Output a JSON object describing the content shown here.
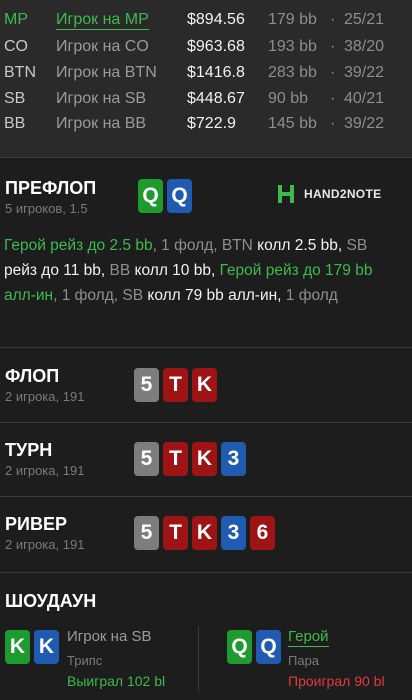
{
  "players": [
    {
      "pos": "MP",
      "name": "Игрок на MP",
      "stack": "$894.56",
      "bb": "179 bb",
      "sep": "·",
      "record": "25/21",
      "hero": true
    },
    {
      "pos": "CO",
      "name": "Игрок на CO",
      "stack": "$963.68",
      "bb": "193 bb",
      "sep": "·",
      "record": "38/20",
      "hero": false
    },
    {
      "pos": "BTN",
      "name": "Игрок на BTN",
      "stack": "$1416.8",
      "bb": "283 bb",
      "sep": "·",
      "record": "39/22",
      "hero": false
    },
    {
      "pos": "SB",
      "name": "Игрок на SB",
      "stack": "$448.67",
      "bb": "90 bb",
      "sep": "·",
      "record": "40/21",
      "hero": false
    },
    {
      "pos": "BB",
      "name": "Игрок на BB",
      "stack": "$722.9",
      "bb": "145 bb",
      "sep": "·",
      "record": "39/22",
      "hero": false
    }
  ],
  "preflop": {
    "title": "ПРЕФЛОП",
    "subtitle": "5 игроков, 1.5",
    "hero_cards": [
      {
        "rank": "Q",
        "color": "green"
      },
      {
        "rank": "Q",
        "color": "blue"
      }
    ],
    "logo_text": "HAND2NOTE",
    "actions": [
      {
        "text": "Герой рейз до 2.5 bb",
        "style": "hero"
      },
      {
        "text": ", 1 фолд, ",
        "style": "gray"
      },
      {
        "text": "BTN",
        "style": "gray"
      },
      {
        "text": " колл 2.5 bb,",
        "style": "white"
      },
      {
        "text": " SB",
        "style": "gray"
      },
      {
        "text": " рейз до 11 bb, ",
        "style": "white"
      },
      {
        "text": "BB",
        "style": "gray"
      },
      {
        "text": " колл 10 bb, ",
        "style": "white"
      },
      {
        "text": "Герой рейз до 179 bb алл-ин",
        "style": "hero"
      },
      {
        "text": ", 1 фолд, ",
        "style": "gray"
      },
      {
        "text": "SB",
        "style": "gray"
      },
      {
        "text": " колл 79 bb алл-ин, ",
        "style": "white"
      },
      {
        "text": "1 фолд",
        "style": "gray"
      }
    ]
  },
  "flop": {
    "title": "ФЛОП",
    "subtitle": "2 игрока, 191",
    "cards": [
      {
        "rank": "5",
        "color": "gray"
      },
      {
        "rank": "T",
        "color": "red"
      },
      {
        "rank": "K",
        "color": "red"
      }
    ]
  },
  "turn": {
    "title": "ТУРН",
    "subtitle": "2 игрока, 191",
    "cards": [
      {
        "rank": "5",
        "color": "gray"
      },
      {
        "rank": "T",
        "color": "red"
      },
      {
        "rank": "K",
        "color": "red"
      },
      {
        "rank": "3",
        "color": "blue"
      }
    ]
  },
  "river": {
    "title": "РИВЕР",
    "subtitle": "2 игрока, 191",
    "cards": [
      {
        "rank": "5",
        "color": "gray"
      },
      {
        "rank": "T",
        "color": "red"
      },
      {
        "rank": "K",
        "color": "red"
      },
      {
        "rank": "3",
        "color": "blue"
      },
      {
        "rank": "6",
        "color": "red"
      }
    ]
  },
  "showdown": {
    "title": "ШОУДАУН",
    "left": {
      "cards": [
        {
          "rank": "K",
          "color": "green"
        },
        {
          "rank": "K",
          "color": "blue"
        }
      ],
      "name": "Игрок на SB",
      "hand": "Трипс",
      "result": "Выиграл 102 bl"
    },
    "right": {
      "cards": [
        {
          "rank": "Q",
          "color": "green"
        },
        {
          "rank": "Q",
          "color": "blue"
        }
      ],
      "name": "Герой",
      "hand": "Пара",
      "result": "Проиграл 90 bl"
    }
  },
  "colors": {
    "background": "#1d1d1d",
    "hero_green": "#3dba4e",
    "card_green": "#1e9b2e",
    "card_blue": "#1f5bb0",
    "card_red": "#9e1414",
    "card_gray": "#7d7d7d",
    "lose_red": "#e23b3b"
  }
}
